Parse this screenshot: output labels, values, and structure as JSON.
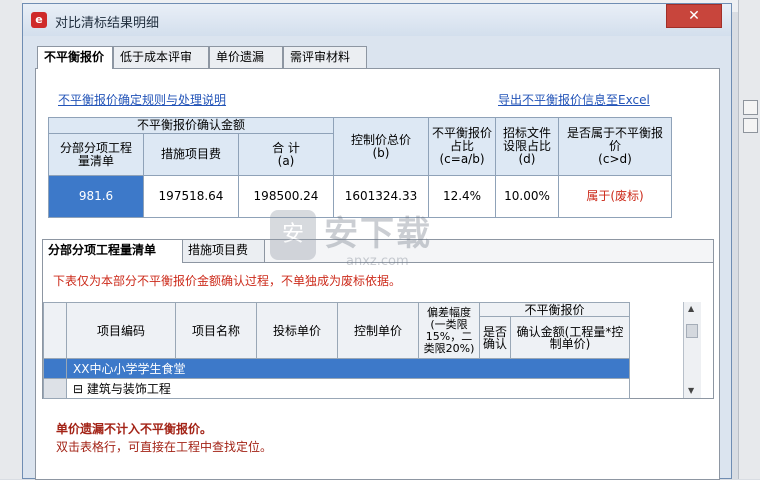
{
  "dialog": {
    "title": "对比清标结果明细",
    "close_glyph": "✕"
  },
  "tabs": [
    "不平衡报价",
    "低于成本评审",
    "单价遗漏",
    "需评审材料"
  ],
  "links": {
    "rules": "不平衡报价确定规则与处理说明",
    "export": "导出不平衡报价信息至Excel"
  },
  "summary": {
    "group_header": "不平衡报价确认金额",
    "h_bill": "分部分项工程量清单",
    "h_measure": "措施项目费",
    "h_total": "合 计",
    "h_total_sub": "(a)",
    "h_control": "控制价总价",
    "h_control_sub": "(b)",
    "h_ratio": "不平衡报价占比",
    "h_ratio_sub": "(c=a/b)",
    "h_tender": "招标文件设限占比",
    "h_tender_sub": "(d)",
    "h_is": "是否属于不平衡报价",
    "h_is_sub": "(c>d)",
    "v_bill": "981.6",
    "v_measure": "197518.64",
    "v_total": "198500.24",
    "v_control": "1601324.33",
    "v_ratio": "12.4%",
    "v_tender": "10.00%",
    "v_is": "属于(废标)"
  },
  "inner_tabs": [
    "分部分项工程量清单",
    "措施项目费"
  ],
  "note": "下表仅为本部分不平衡报价金额确认过程，不单独成为废标依据。",
  "grid": {
    "h_code": "项目编码",
    "h_name": "项目名称",
    "h_bid": "投标单价",
    "h_ctrl": "控制单价",
    "h_dev": "偏差幅度(一类限15%，二类限20%)",
    "h_unb": "不平衡报价",
    "h_yes": "是否确认",
    "h_amt": "确认金额(工程量*控制单价)",
    "row1": "XX中心小学学生食堂",
    "row2": "建筑与装饰工程",
    "expand": "⊟"
  },
  "footer": {
    "line1": "单价遗漏不计入不平衡报价。",
    "line2": "双击表格行，可直接在工程中查找定位。"
  },
  "watermark": {
    "big": "安下载",
    "small": "anxz.com",
    "shield": "安"
  },
  "colors": {
    "selected": "#3d79c9",
    "warning": "#cc2a1a",
    "link": "#2354b8",
    "close": "#c8453c"
  }
}
